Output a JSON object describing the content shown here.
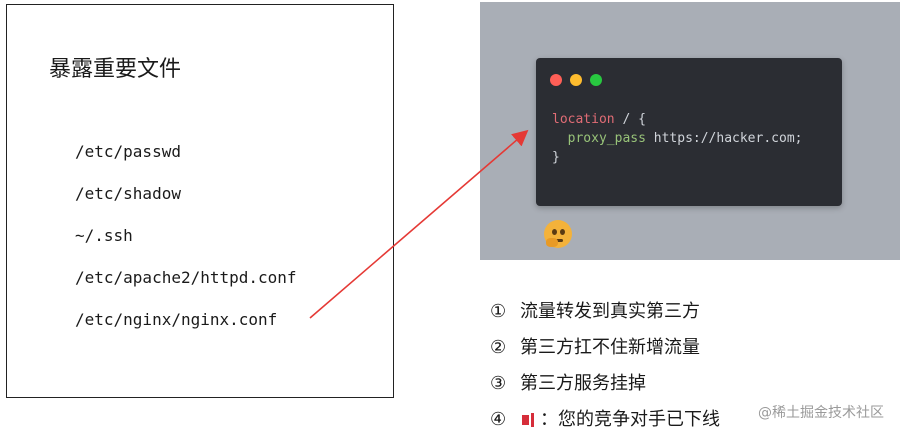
{
  "left_panel": {
    "title": "暴露重要文件",
    "paths": [
      "/etc/passwd",
      "/etc/shadow",
      "~/.ssh",
      "/etc/apache2/httpd.conf",
      "/etc/nginx/nginx.conf"
    ]
  },
  "code_window": {
    "line1_keyword": "location",
    "line1_rest": " / {",
    "line2_property": "proxy_pass",
    "line2_value": " https://hacker.com;",
    "line3": "}"
  },
  "reasons": [
    {
      "num": "①",
      "text": "流量转发到真实第三方"
    },
    {
      "num": "②",
      "text": "第三方扛不住新增流量"
    },
    {
      "num": "③",
      "text": "第三方服务挂掉"
    },
    {
      "num": "④",
      "text": "：您的竞争对手已下线"
    }
  ],
  "watermark": "@稀土掘金技术社区",
  "colors": {
    "arrow": "#e53935",
    "code_bg": "#2b2d33",
    "image_bg": "#a9aeb6"
  },
  "icons": [
    "thinking-face-icon",
    "flag-icon"
  ]
}
